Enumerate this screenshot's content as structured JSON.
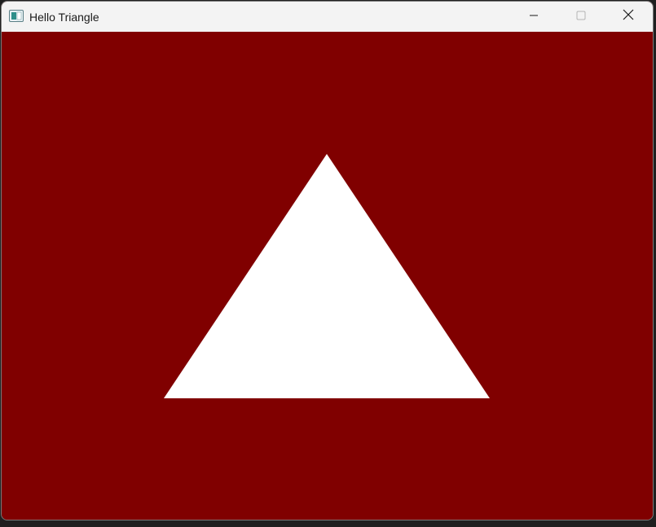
{
  "window": {
    "title": "Hello Triangle",
    "icon": "application-window-icon"
  },
  "caption_buttons": {
    "minimize": "minimize-icon",
    "maximize": "maximize-icon",
    "close": "close-icon"
  },
  "colors": {
    "clear_color": "#800000",
    "triangle_color": "#ffffff",
    "titlebar": "#f3f3f3"
  }
}
